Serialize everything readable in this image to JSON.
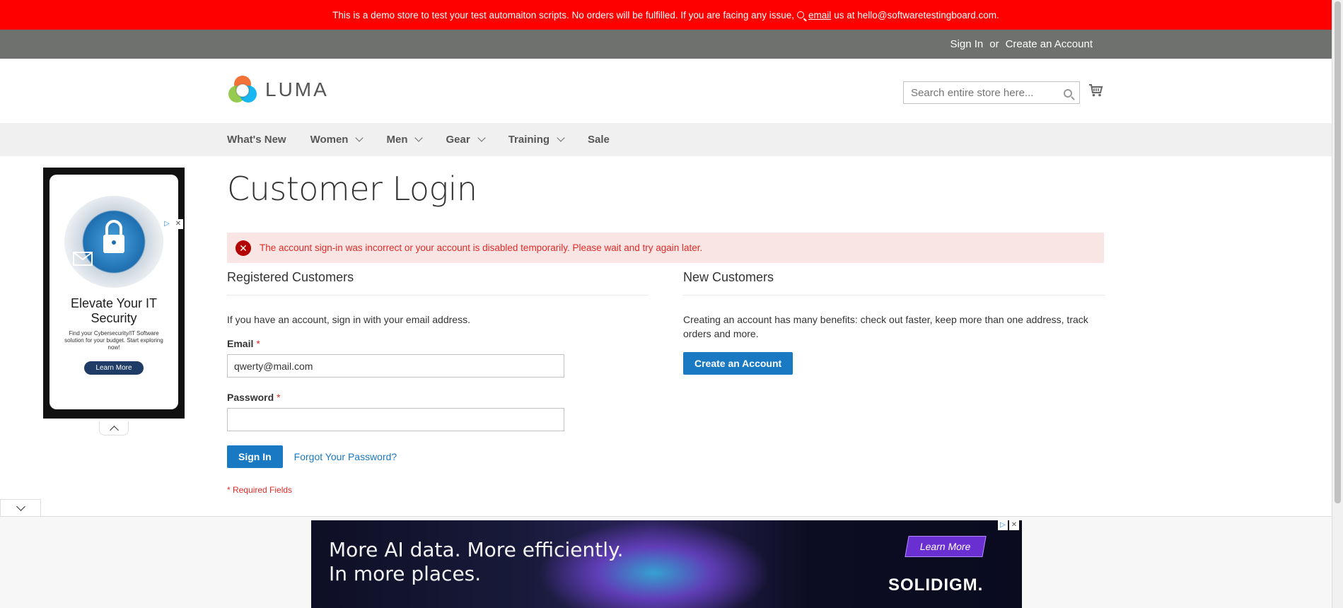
{
  "demo_notice": {
    "text_before": "This is a demo store to test your test automaiton scripts. No orders will be fulfilled. If you are facing any issue,",
    "email_link": "email",
    "text_after": "us at hello@softwaretestingboard.com."
  },
  "panel": {
    "sign_in": "Sign In",
    "or": "or",
    "create_account": "Create an Account"
  },
  "header": {
    "logo_text": "LUMA",
    "search_placeholder": "Search entire store here..."
  },
  "nav": {
    "items": [
      {
        "label": "What's New",
        "has_dropdown": false
      },
      {
        "label": "Women",
        "has_dropdown": true
      },
      {
        "label": "Men",
        "has_dropdown": true
      },
      {
        "label": "Gear",
        "has_dropdown": true
      },
      {
        "label": "Training",
        "has_dropdown": true
      },
      {
        "label": "Sale",
        "has_dropdown": false
      }
    ]
  },
  "page": {
    "title": "Customer Login",
    "error_message": "The account sign-in was incorrect or your account is disabled temporarily. Please wait and try again later."
  },
  "registered": {
    "title": "Registered Customers",
    "intro": "If you have an account, sign in with your email address.",
    "email_label": "Email",
    "email_value": "qwerty@mail.com",
    "password_label": "Password",
    "password_value": "",
    "required_star": "*",
    "sign_in_button": "Sign In",
    "forgot_link": "Forgot Your Password?",
    "required_note": "* Required Fields"
  },
  "new_customers": {
    "title": "New Customers",
    "text": "Creating an account has many benefits: check out faster, keep more than one address, track orders and more.",
    "button": "Create an Account"
  },
  "side_ad": {
    "title": "Elevate Your IT Security",
    "body": "Find your Cybersecurity/IT Software solution for your budget. Start exploring now!",
    "cta": "Learn More"
  },
  "bottom_ad": {
    "line1": "More AI data. More efficiently.",
    "line2": "In more places.",
    "cta": "Learn More",
    "brand": "SOLIDIGM."
  },
  "colors": {
    "demo_bar": "#ff0000",
    "panel": "#6e716e",
    "primary": "#1979c3",
    "error_bg": "#fae5e5",
    "error_text": "#e02b27"
  }
}
